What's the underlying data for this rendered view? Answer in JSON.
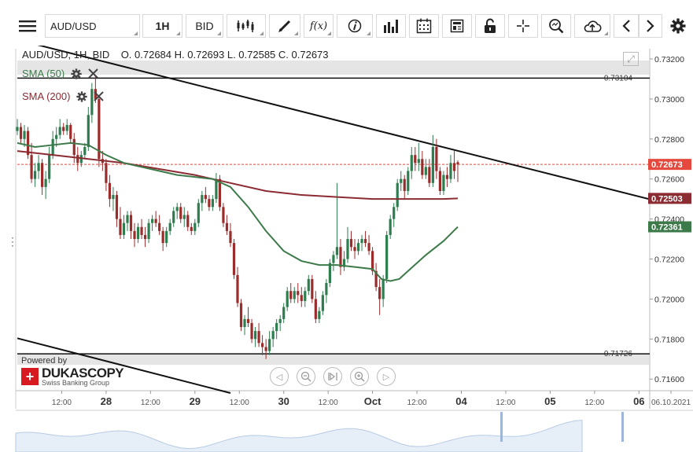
{
  "toolbar": {
    "symbol": "AUD/USD",
    "timeframe": "1H",
    "side": "BID",
    "function_label": "f(x)"
  },
  "header": {
    "text": "AUD/USD, 1H, BID    O. 0.72684 H. 0.72693 L. 0.72585 C. 0.72673"
  },
  "indicators": [
    {
      "label": "SMA (50)",
      "color": "#3d7a4a"
    },
    {
      "label": "SMA (200)",
      "color": "#8b2b32"
    }
  ],
  "branding": {
    "powered_by": "Powered by",
    "name": "DUKASCOPY",
    "tagline": "Swiss Banking Group"
  },
  "colors": {
    "bull": "#2e7d4f",
    "bear": "#9b2c2c",
    "sma50": "#3d7a4a",
    "sma200": "#8b2b32",
    "last_price_bg": "#e5483c",
    "sma200_bg": "#8b2b32",
    "sma50_bg": "#3d7a4a"
  },
  "chart_data": {
    "type": "candlestick",
    "symbol": "AUD/USD",
    "interval": "1H",
    "y_ticks": [
      "0.73200",
      "0.73000",
      "0.72800",
      "0.72600",
      "0.72400",
      "0.72200",
      "0.72000",
      "0.71800",
      "0.71600"
    ],
    "ylim": [
      0.7155,
      0.7325
    ],
    "x_ticks": [
      "12:00",
      "28",
      "12:00",
      "29",
      "12:00",
      "30",
      "12:00",
      "Oct",
      "12:00",
      "04",
      "12:00",
      "05",
      "12:00",
      "06",
      "06.10.2021"
    ],
    "x_tick_positions": [
      0.5,
      1,
      1.5,
      2,
      2.5,
      3,
      3.5,
      4,
      4.5,
      5,
      5.5,
      6,
      6.5,
      7,
      7.2
    ],
    "xlim": [
      0.0,
      7.2
    ],
    "price_labels": {
      "last": "0.72673",
      "sma200": "0.72503",
      "sma50": "0.72361"
    },
    "horizontal_lines": [
      {
        "value": 0.73104,
        "label": "0.73104"
      },
      {
        "value": 0.71726,
        "label": "0.71726"
      }
    ],
    "trendlines": [
      {
        "from": [
          0.0,
          0.73296
        ],
        "to": [
          7.2,
          0.7249
        ]
      },
      {
        "from": [
          0.0,
          0.71804
        ],
        "to": [
          2.4,
          0.7153
        ]
      }
    ],
    "candles": [
      [
        0.0,
        0.7284,
        0.729,
        0.7282,
        0.7286
      ],
      [
        0.04,
        0.7286,
        0.7288,
        0.7278,
        0.728
      ],
      [
        0.08,
        0.728,
        0.7287,
        0.7276,
        0.7284
      ],
      [
        0.12,
        0.7284,
        0.7286,
        0.727,
        0.7272
      ],
      [
        0.16,
        0.7272,
        0.7278,
        0.7258,
        0.726
      ],
      [
        0.2,
        0.726,
        0.7268,
        0.7256,
        0.7264
      ],
      [
        0.24,
        0.7264,
        0.7272,
        0.726,
        0.7268
      ],
      [
        0.28,
        0.7268,
        0.727,
        0.7252,
        0.7256
      ],
      [
        0.32,
        0.7256,
        0.7264,
        0.725,
        0.726
      ],
      [
        0.36,
        0.726,
        0.7276,
        0.7258,
        0.7272
      ],
      [
        0.4,
        0.7272,
        0.7284,
        0.727,
        0.728
      ],
      [
        0.44,
        0.728,
        0.7286,
        0.7276,
        0.7282
      ],
      [
        0.48,
        0.7282,
        0.729,
        0.728,
        0.7286
      ],
      [
        0.52,
        0.7286,
        0.7288,
        0.7282,
        0.7284
      ],
      [
        0.56,
        0.7284,
        0.729,
        0.7282,
        0.7287
      ],
      [
        0.6,
        0.7287,
        0.7288,
        0.7278,
        0.728
      ],
      [
        0.64,
        0.728,
        0.7283,
        0.7268,
        0.7272
      ],
      [
        0.68,
        0.7272,
        0.7276,
        0.7264,
        0.7268
      ],
      [
        0.72,
        0.7268,
        0.7274,
        0.7266,
        0.7272
      ],
      [
        0.76,
        0.7272,
        0.7278,
        0.727,
        0.7276
      ],
      [
        0.8,
        0.7276,
        0.7296,
        0.7274,
        0.7292
      ],
      [
        0.84,
        0.7292,
        0.7308,
        0.7288,
        0.7305
      ],
      [
        0.88,
        0.7305,
        0.7312,
        0.7298,
        0.73
      ],
      [
        0.92,
        0.73,
        0.7301,
        0.7266,
        0.727
      ],
      [
        0.96,
        0.727,
        0.7274,
        0.7264,
        0.7268
      ],
      [
        1.0,
        0.7268,
        0.727,
        0.7254,
        0.7258
      ],
      [
        1.04,
        0.7258,
        0.7262,
        0.7246,
        0.725
      ],
      [
        1.08,
        0.725,
        0.7256,
        0.7244,
        0.7252
      ],
      [
        1.12,
        0.7252,
        0.7254,
        0.7236,
        0.724
      ],
      [
        1.16,
        0.724,
        0.7246,
        0.723,
        0.7232
      ],
      [
        1.2,
        0.7232,
        0.7242,
        0.723,
        0.7238
      ],
      [
        1.24,
        0.7238,
        0.7244,
        0.7234,
        0.7242
      ],
      [
        1.28,
        0.7242,
        0.7244,
        0.723,
        0.7234
      ],
      [
        1.32,
        0.7234,
        0.7238,
        0.7226,
        0.723
      ],
      [
        1.36,
        0.723,
        0.7238,
        0.7228,
        0.7236
      ],
      [
        1.4,
        0.7236,
        0.724,
        0.723,
        0.7232
      ],
      [
        1.44,
        0.7232,
        0.7236,
        0.7226,
        0.723
      ],
      [
        1.48,
        0.723,
        0.724,
        0.7228,
        0.7238
      ],
      [
        1.52,
        0.7238,
        0.7242,
        0.7234,
        0.724
      ],
      [
        1.56,
        0.724,
        0.7244,
        0.7236,
        0.7238
      ],
      [
        1.6,
        0.7238,
        0.7242,
        0.7232,
        0.7234
      ],
      [
        1.64,
        0.7234,
        0.7236,
        0.7224,
        0.7228
      ],
      [
        1.68,
        0.7228,
        0.7236,
        0.7226,
        0.7234
      ],
      [
        1.72,
        0.7234,
        0.724,
        0.7232,
        0.7238
      ],
      [
        1.76,
        0.7238,
        0.7246,
        0.7236,
        0.7244
      ],
      [
        1.8,
        0.7244,
        0.7248,
        0.724,
        0.7246
      ],
      [
        1.84,
        0.7246,
        0.7248,
        0.7238,
        0.724
      ],
      [
        1.88,
        0.724,
        0.7246,
        0.7236,
        0.7242
      ],
      [
        1.92,
        0.7242,
        0.7244,
        0.7234,
        0.7236
      ],
      [
        1.96,
        0.7236,
        0.7238,
        0.7232,
        0.7234
      ],
      [
        2.0,
        0.7234,
        0.724,
        0.7232,
        0.7238
      ],
      [
        2.04,
        0.7238,
        0.725,
        0.7236,
        0.7248
      ],
      [
        2.08,
        0.7248,
        0.7254,
        0.7244,
        0.7252
      ],
      [
        2.12,
        0.7252,
        0.7256,
        0.7248,
        0.725
      ],
      [
        2.16,
        0.725,
        0.7252,
        0.7244,
        0.7246
      ],
      [
        2.2,
        0.7246,
        0.7252,
        0.7244,
        0.725
      ],
      [
        2.24,
        0.725,
        0.7263,
        0.7248,
        0.726
      ],
      [
        2.28,
        0.726,
        0.7262,
        0.7244,
        0.7246
      ],
      [
        2.32,
        0.7246,
        0.7248,
        0.7236,
        0.7238
      ],
      [
        2.36,
        0.7238,
        0.7242,
        0.7232,
        0.7234
      ],
      [
        2.4,
        0.7234,
        0.7238,
        0.7226,
        0.7228
      ],
      [
        2.44,
        0.7228,
        0.723,
        0.721,
        0.7212
      ],
      [
        2.48,
        0.7212,
        0.7216,
        0.7196,
        0.7198
      ],
      [
        2.52,
        0.7198,
        0.72,
        0.7184,
        0.7186
      ],
      [
        2.56,
        0.7186,
        0.7192,
        0.7182,
        0.719
      ],
      [
        2.6,
        0.719,
        0.7196,
        0.7186,
        0.7188
      ],
      [
        2.64,
        0.7188,
        0.719,
        0.7178,
        0.718
      ],
      [
        2.68,
        0.718,
        0.7186,
        0.7176,
        0.7184
      ],
      [
        2.72,
        0.7184,
        0.7188,
        0.7176,
        0.7178
      ],
      [
        2.76,
        0.7178,
        0.7182,
        0.7172,
        0.7176
      ],
      [
        2.8,
        0.7176,
        0.718,
        0.717,
        0.7174
      ],
      [
        2.84,
        0.7174,
        0.7184,
        0.7172,
        0.718
      ],
      [
        2.88,
        0.718,
        0.7186,
        0.7176,
        0.7184
      ],
      [
        2.92,
        0.7184,
        0.719,
        0.718,
        0.7188
      ],
      [
        2.96,
        0.7188,
        0.7192,
        0.7184,
        0.719
      ],
      [
        3.0,
        0.719,
        0.7198,
        0.7188,
        0.7196
      ],
      [
        3.04,
        0.7196,
        0.7206,
        0.7194,
        0.7204
      ],
      [
        3.08,
        0.7204,
        0.7208,
        0.7198,
        0.72
      ],
      [
        3.12,
        0.72,
        0.7206,
        0.7198,
        0.7204
      ],
      [
        3.16,
        0.7204,
        0.7208,
        0.7198,
        0.7202
      ],
      [
        3.2,
        0.7202,
        0.7206,
        0.7196,
        0.7199
      ],
      [
        3.24,
        0.7199,
        0.7206,
        0.7196,
        0.7204
      ],
      [
        3.28,
        0.7204,
        0.7212,
        0.7202,
        0.721
      ],
      [
        3.32,
        0.721,
        0.7212,
        0.7198,
        0.72
      ],
      [
        3.36,
        0.72,
        0.7204,
        0.7188,
        0.719
      ],
      [
        3.4,
        0.719,
        0.7196,
        0.7188,
        0.7194
      ],
      [
        3.44,
        0.7194,
        0.7204,
        0.7192,
        0.7202
      ],
      [
        3.48,
        0.7202,
        0.721,
        0.7198,
        0.7208
      ],
      [
        3.52,
        0.7208,
        0.722,
        0.7206,
        0.7218
      ],
      [
        3.56,
        0.7218,
        0.7224,
        0.7214,
        0.7222
      ],
      [
        3.6,
        0.7222,
        0.7258,
        0.722,
        0.7226
      ],
      [
        3.64,
        0.7226,
        0.723,
        0.7212,
        0.7216
      ],
      [
        3.68,
        0.7216,
        0.7224,
        0.7214,
        0.722
      ],
      [
        3.72,
        0.722,
        0.7236,
        0.7218,
        0.723
      ],
      [
        3.76,
        0.723,
        0.7234,
        0.7224,
        0.7226
      ],
      [
        3.8,
        0.7226,
        0.723,
        0.722,
        0.7224
      ],
      [
        3.84,
        0.7224,
        0.723,
        0.7222,
        0.7228
      ],
      [
        3.88,
        0.7228,
        0.7232,
        0.7224,
        0.723
      ],
      [
        3.92,
        0.723,
        0.7234,
        0.7226,
        0.7228
      ],
      [
        3.96,
        0.7228,
        0.7232,
        0.7222,
        0.7224
      ],
      [
        4.0,
        0.7224,
        0.7226,
        0.7212,
        0.7214
      ],
      [
        4.04,
        0.7214,
        0.7218,
        0.7204,
        0.7206
      ],
      [
        4.08,
        0.7206,
        0.721,
        0.7192,
        0.72
      ],
      [
        4.12,
        0.72,
        0.7212,
        0.7196,
        0.721
      ],
      [
        4.16,
        0.721,
        0.7234,
        0.7208,
        0.7232
      ],
      [
        4.2,
        0.7232,
        0.7242,
        0.723,
        0.724
      ],
      [
        4.24,
        0.724,
        0.7248,
        0.7236,
        0.7246
      ],
      [
        4.28,
        0.7246,
        0.726,
        0.7244,
        0.7258
      ],
      [
        4.32,
        0.7258,
        0.7264,
        0.7254,
        0.726
      ],
      [
        4.36,
        0.726,
        0.7262,
        0.725,
        0.7254
      ],
      [
        4.4,
        0.7254,
        0.7266,
        0.7252,
        0.7264
      ],
      [
        4.44,
        0.7264,
        0.7276,
        0.726,
        0.7272
      ],
      [
        4.48,
        0.7272,
        0.7276,
        0.7264,
        0.7268
      ],
      [
        4.52,
        0.7268,
        0.7278,
        0.7264,
        0.727
      ],
      [
        4.56,
        0.727,
        0.7274,
        0.726,
        0.7262
      ],
      [
        4.6,
        0.7262,
        0.727,
        0.726,
        0.7266
      ],
      [
        4.64,
        0.7266,
        0.727,
        0.7256,
        0.7258
      ],
      [
        4.68,
        0.7258,
        0.7282,
        0.7256,
        0.7276
      ],
      [
        4.72,
        0.7276,
        0.728,
        0.726,
        0.7264
      ],
      [
        4.76,
        0.7264,
        0.7266,
        0.7252,
        0.7254
      ],
      [
        4.8,
        0.7254,
        0.7264,
        0.7252,
        0.7262
      ],
      [
        4.84,
        0.7262,
        0.7266,
        0.7256,
        0.726
      ],
      [
        4.88,
        0.726,
        0.7272,
        0.7258,
        0.7268
      ],
      [
        4.92,
        0.7268,
        0.7274,
        0.726,
        0.7264
      ],
      [
        4.96,
        0.72684,
        0.72693,
        0.72585,
        0.72673
      ]
    ],
    "sma50": [
      [
        0.0,
        0.7278
      ],
      [
        0.2,
        0.7276
      ],
      [
        0.4,
        0.7277
      ],
      [
        0.6,
        0.7278
      ],
      [
        0.8,
        0.7277
      ],
      [
        1.0,
        0.7272
      ],
      [
        1.2,
        0.7268
      ],
      [
        1.4,
        0.7266
      ],
      [
        1.6,
        0.7264
      ],
      [
        1.8,
        0.7262
      ],
      [
        2.0,
        0.7261
      ],
      [
        2.2,
        0.726
      ],
      [
        2.4,
        0.7256
      ],
      [
        2.6,
        0.7246
      ],
      [
        2.8,
        0.7234
      ],
      [
        3.0,
        0.7224
      ],
      [
        3.2,
        0.7219
      ],
      [
        3.4,
        0.7217
      ],
      [
        3.6,
        0.7217
      ],
      [
        3.8,
        0.7216
      ],
      [
        4.0,
        0.7215
      ],
      [
        4.1,
        0.721
      ],
      [
        4.2,
        0.7209
      ],
      [
        4.3,
        0.721
      ],
      [
        4.4,
        0.7214
      ],
      [
        4.6,
        0.7222
      ],
      [
        4.8,
        0.7229
      ],
      [
        4.96,
        0.72361
      ]
    ],
    "sma200": [
      [
        0.0,
        0.7274
      ],
      [
        0.4,
        0.7272
      ],
      [
        0.8,
        0.727
      ],
      [
        1.2,
        0.7268
      ],
      [
        1.6,
        0.7265
      ],
      [
        2.0,
        0.7262
      ],
      [
        2.4,
        0.7258
      ],
      [
        2.8,
        0.7254
      ],
      [
        3.2,
        0.7252
      ],
      [
        3.6,
        0.7251
      ],
      [
        4.0,
        0.725
      ],
      [
        4.4,
        0.725
      ],
      [
        4.8,
        0.725
      ],
      [
        4.96,
        0.72503
      ]
    ]
  }
}
